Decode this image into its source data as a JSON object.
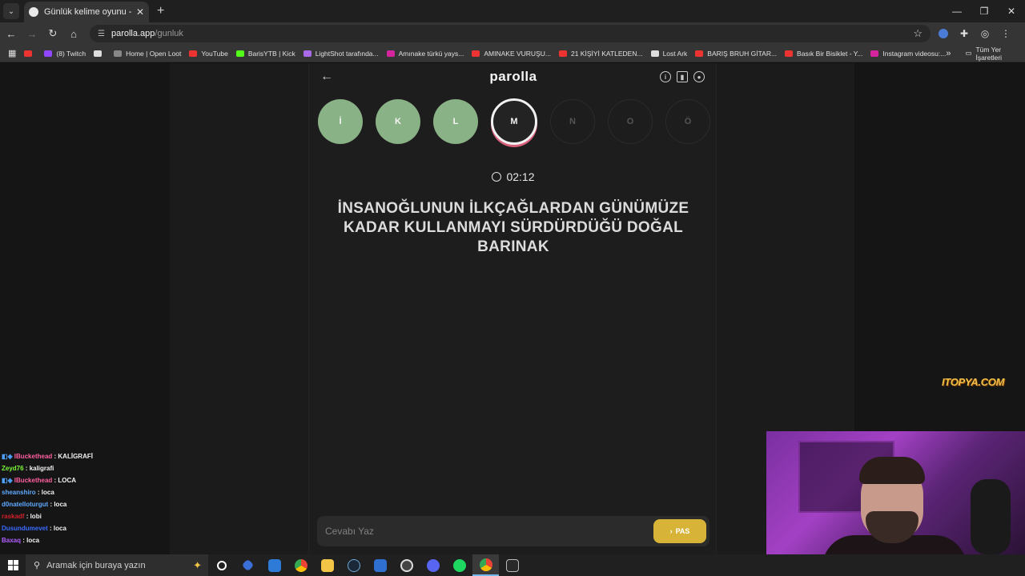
{
  "browser": {
    "tab_title": "Günlük kelime oyunu - parolla",
    "tab_close": "✕",
    "new_tab": "+",
    "url_host": "parolla.app",
    "url_path": "/gunluk",
    "bookmarks": [
      {
        "label": "",
        "color": "#e33"
      },
      {
        "label": "(8) Twitch",
        "color": "#9147ff"
      },
      {
        "label": "",
        "color": "#ddd"
      },
      {
        "label": "Home | Open Loot",
        "color": "#888"
      },
      {
        "label": "YouTube",
        "color": "#e33"
      },
      {
        "label": "BarisYTB | Kick",
        "color": "#53fc18"
      },
      {
        "label": "LightShot tarafında...",
        "color": "#a86ae8"
      },
      {
        "label": "Amınake türkü yays...",
        "color": "#d6249f"
      },
      {
        "label": "AMINAKE VURUŞU...",
        "color": "#e33"
      },
      {
        "label": "21 KİŞİYİ KATLEDEN...",
        "color": "#e33"
      },
      {
        "label": "Lost Ark",
        "color": "#ddd"
      },
      {
        "label": "BARIŞ BRUH GİTAR...",
        "color": "#e33"
      },
      {
        "label": "Basık Bir Bisiklet - Y...",
        "color": "#e33"
      },
      {
        "label": "Instagram videosu:...",
        "color": "#d6249f"
      }
    ],
    "bookmarks_more": "»",
    "all_bookmarks": "Tüm Yer İşaretleri"
  },
  "game": {
    "logo": "parolla",
    "letters": [
      {
        "char": "İ",
        "state": "done"
      },
      {
        "char": "K",
        "state": "done"
      },
      {
        "char": "L",
        "state": "done"
      },
      {
        "char": "M",
        "state": "active"
      },
      {
        "char": "N",
        "state": "pending"
      },
      {
        "char": "O",
        "state": "pending"
      },
      {
        "char": "Ö",
        "state": "pending"
      }
    ],
    "timer": "02:12",
    "question": "İNSANOĞLUNUN İLKÇAĞLARDAN GÜNÜMÜZE KADAR KULLANMAYI SÜRDÜRDÜĞÜ DOĞAL BARINAK",
    "answer_placeholder": "Cevabı Yaz",
    "pass_label": "PAS"
  },
  "watermark": "ITOPYA.COM",
  "chat": [
    {
      "user": "lBuckethead",
      "msg": "KALİGRAFİ",
      "color": "#ff5fa0",
      "badges": true
    },
    {
      "user": "Zeyd76",
      "msg": "kaligrafi",
      "color": "#7cfc3a",
      "badges": false
    },
    {
      "user": "lBuckethead",
      "msg": "LOCA",
      "color": "#ff5fa0",
      "badges": true
    },
    {
      "user": "sheanshiro",
      "msg": "loca",
      "color": "#5fa8ff",
      "badges": false
    },
    {
      "user": "d0natelloturgut",
      "msg": "loca",
      "color": "#5fa8ff",
      "badges": false
    },
    {
      "user": "raskadf",
      "msg": "lobi",
      "color": "#d0202a",
      "badges": false
    },
    {
      "user": "Dusundumevet",
      "msg": "loca",
      "color": "#3a6bff",
      "badges": false
    },
    {
      "user": "Baxaq",
      "msg": "loca",
      "color": "#b05fff",
      "badges": false
    }
  ],
  "taskbar": {
    "search_placeholder": "Aramak için buraya yazın"
  }
}
